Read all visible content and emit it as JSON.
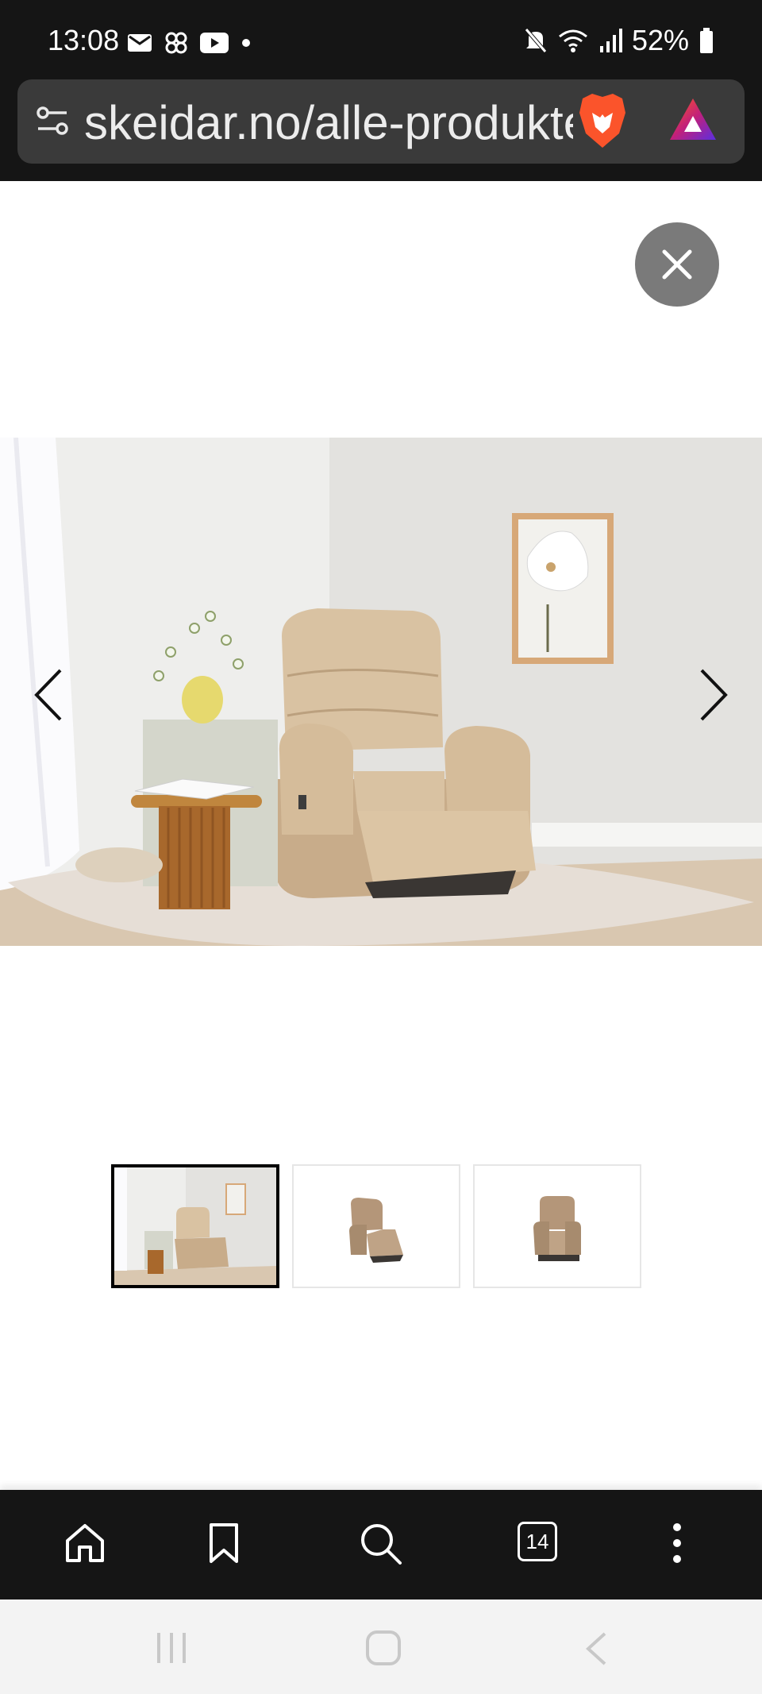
{
  "status_bar": {
    "time": "13:08",
    "notification_icons": [
      "gmail-icon",
      "pinwheel-icon",
      "youtube-icon",
      "dot-icon"
    ],
    "system_icons": [
      "mute-icon",
      "wifi-icon",
      "signal-icon",
      "battery-icon"
    ],
    "battery": "52%"
  },
  "browser": {
    "url": "skeidar.no/alle-produkter",
    "tab_count": "14",
    "toolbar": [
      "home-icon",
      "bookmark-icon",
      "search-icon",
      "tabs-icon",
      "more-icon"
    ]
  },
  "gallery": {
    "image_count": 3,
    "active_index": 0,
    "thumbnails": [
      "room-scene",
      "recliner-angle",
      "recliner-front"
    ]
  },
  "colors": {
    "bar_bg": "#151515",
    "url_box": "#3a3a3a",
    "close_button": "#7a7a7a",
    "brave_orange": "#fb542b"
  }
}
